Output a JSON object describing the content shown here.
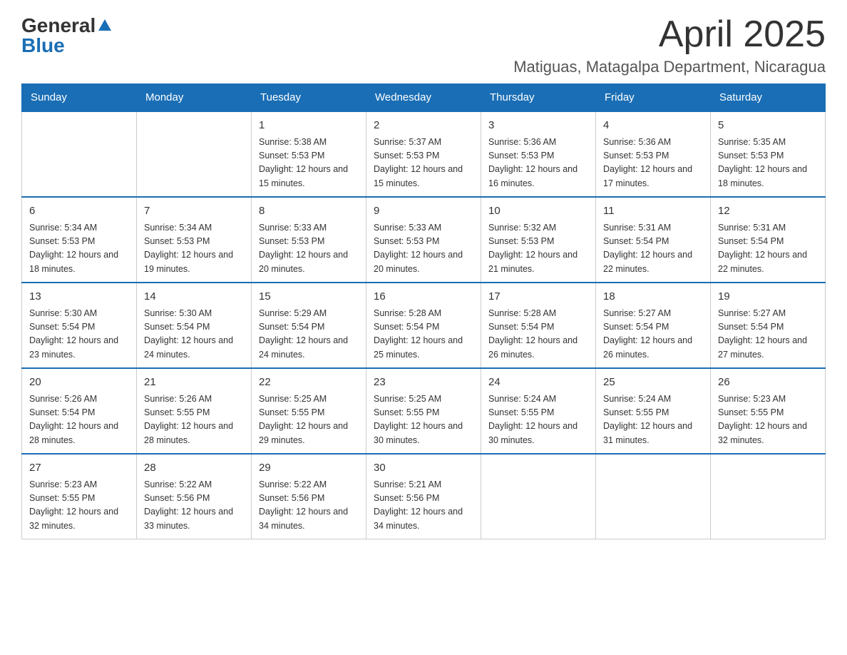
{
  "logo": {
    "general": "General",
    "blue": "Blue"
  },
  "title": {
    "month": "April 2025",
    "location": "Matiguas, Matagalpa Department, Nicaragua"
  },
  "days_of_week": [
    "Sunday",
    "Monday",
    "Tuesday",
    "Wednesday",
    "Thursday",
    "Friday",
    "Saturday"
  ],
  "weeks": [
    [
      {
        "day": "",
        "info": ""
      },
      {
        "day": "",
        "info": ""
      },
      {
        "day": "1",
        "info": "Sunrise: 5:38 AM\nSunset: 5:53 PM\nDaylight: 12 hours and 15 minutes."
      },
      {
        "day": "2",
        "info": "Sunrise: 5:37 AM\nSunset: 5:53 PM\nDaylight: 12 hours and 15 minutes."
      },
      {
        "day": "3",
        "info": "Sunrise: 5:36 AM\nSunset: 5:53 PM\nDaylight: 12 hours and 16 minutes."
      },
      {
        "day": "4",
        "info": "Sunrise: 5:36 AM\nSunset: 5:53 PM\nDaylight: 12 hours and 17 minutes."
      },
      {
        "day": "5",
        "info": "Sunrise: 5:35 AM\nSunset: 5:53 PM\nDaylight: 12 hours and 18 minutes."
      }
    ],
    [
      {
        "day": "6",
        "info": "Sunrise: 5:34 AM\nSunset: 5:53 PM\nDaylight: 12 hours and 18 minutes."
      },
      {
        "day": "7",
        "info": "Sunrise: 5:34 AM\nSunset: 5:53 PM\nDaylight: 12 hours and 19 minutes."
      },
      {
        "day": "8",
        "info": "Sunrise: 5:33 AM\nSunset: 5:53 PM\nDaylight: 12 hours and 20 minutes."
      },
      {
        "day": "9",
        "info": "Sunrise: 5:33 AM\nSunset: 5:53 PM\nDaylight: 12 hours and 20 minutes."
      },
      {
        "day": "10",
        "info": "Sunrise: 5:32 AM\nSunset: 5:53 PM\nDaylight: 12 hours and 21 minutes."
      },
      {
        "day": "11",
        "info": "Sunrise: 5:31 AM\nSunset: 5:54 PM\nDaylight: 12 hours and 22 minutes."
      },
      {
        "day": "12",
        "info": "Sunrise: 5:31 AM\nSunset: 5:54 PM\nDaylight: 12 hours and 22 minutes."
      }
    ],
    [
      {
        "day": "13",
        "info": "Sunrise: 5:30 AM\nSunset: 5:54 PM\nDaylight: 12 hours and 23 minutes."
      },
      {
        "day": "14",
        "info": "Sunrise: 5:30 AM\nSunset: 5:54 PM\nDaylight: 12 hours and 24 minutes."
      },
      {
        "day": "15",
        "info": "Sunrise: 5:29 AM\nSunset: 5:54 PM\nDaylight: 12 hours and 24 minutes."
      },
      {
        "day": "16",
        "info": "Sunrise: 5:28 AM\nSunset: 5:54 PM\nDaylight: 12 hours and 25 minutes."
      },
      {
        "day": "17",
        "info": "Sunrise: 5:28 AM\nSunset: 5:54 PM\nDaylight: 12 hours and 26 minutes."
      },
      {
        "day": "18",
        "info": "Sunrise: 5:27 AM\nSunset: 5:54 PM\nDaylight: 12 hours and 26 minutes."
      },
      {
        "day": "19",
        "info": "Sunrise: 5:27 AM\nSunset: 5:54 PM\nDaylight: 12 hours and 27 minutes."
      }
    ],
    [
      {
        "day": "20",
        "info": "Sunrise: 5:26 AM\nSunset: 5:54 PM\nDaylight: 12 hours and 28 minutes."
      },
      {
        "day": "21",
        "info": "Sunrise: 5:26 AM\nSunset: 5:55 PM\nDaylight: 12 hours and 28 minutes."
      },
      {
        "day": "22",
        "info": "Sunrise: 5:25 AM\nSunset: 5:55 PM\nDaylight: 12 hours and 29 minutes."
      },
      {
        "day": "23",
        "info": "Sunrise: 5:25 AM\nSunset: 5:55 PM\nDaylight: 12 hours and 30 minutes."
      },
      {
        "day": "24",
        "info": "Sunrise: 5:24 AM\nSunset: 5:55 PM\nDaylight: 12 hours and 30 minutes."
      },
      {
        "day": "25",
        "info": "Sunrise: 5:24 AM\nSunset: 5:55 PM\nDaylight: 12 hours and 31 minutes."
      },
      {
        "day": "26",
        "info": "Sunrise: 5:23 AM\nSunset: 5:55 PM\nDaylight: 12 hours and 32 minutes."
      }
    ],
    [
      {
        "day": "27",
        "info": "Sunrise: 5:23 AM\nSunset: 5:55 PM\nDaylight: 12 hours and 32 minutes."
      },
      {
        "day": "28",
        "info": "Sunrise: 5:22 AM\nSunset: 5:56 PM\nDaylight: 12 hours and 33 minutes."
      },
      {
        "day": "29",
        "info": "Sunrise: 5:22 AM\nSunset: 5:56 PM\nDaylight: 12 hours and 34 minutes."
      },
      {
        "day": "30",
        "info": "Sunrise: 5:21 AM\nSunset: 5:56 PM\nDaylight: 12 hours and 34 minutes."
      },
      {
        "day": "",
        "info": ""
      },
      {
        "day": "",
        "info": ""
      },
      {
        "day": "",
        "info": ""
      }
    ]
  ]
}
